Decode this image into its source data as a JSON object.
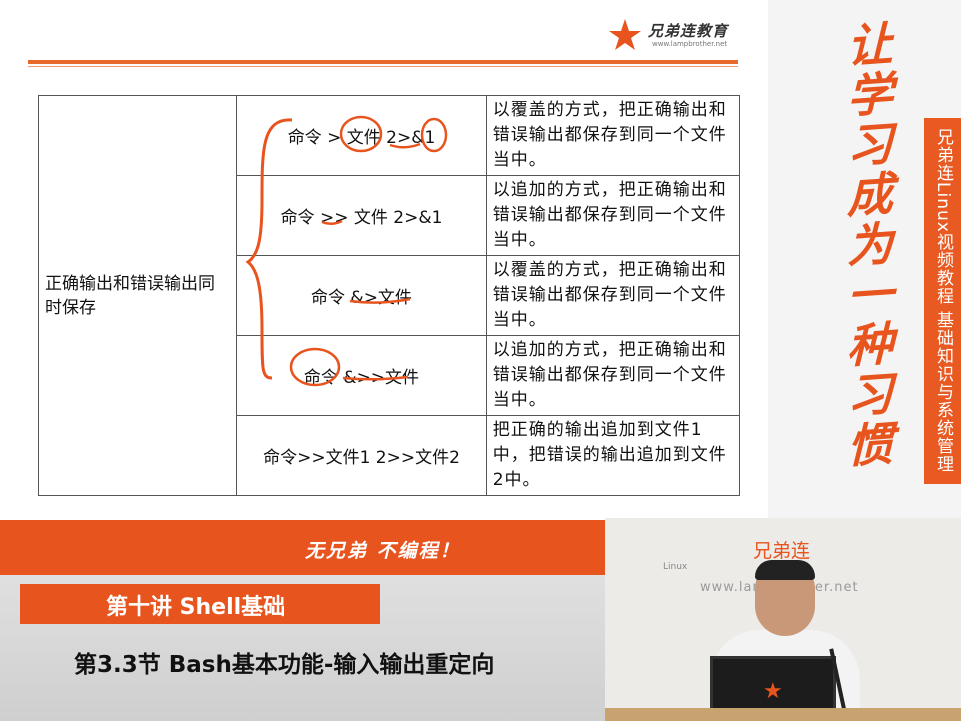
{
  "logo": {
    "brand_text": "兄弟连教育",
    "url": "www.lampbrother.net"
  },
  "table": {
    "left_label": "正确输出和错误输出同时保存",
    "rows": [
      {
        "command": "命令 > 文件 2>&1",
        "description": "以覆盖的方式，把正确输出和错误输出都保存到同一个文件当中。"
      },
      {
        "command": "命令 >> 文件 2>&1",
        "description": "以追加的方式，把正确输出和错误输出都保存到同一个文件当中。"
      },
      {
        "command": "命令 &>文件",
        "description": "以覆盖的方式，把正确输出和错误输出都保存到同一个文件当中。"
      },
      {
        "command": "命令 &>>文件",
        "description": "以追加的方式，把正确输出和错误输出都保存到同一个文件当中。"
      },
      {
        "command": "命令>>文件1  2>>文件2",
        "description": "把正确的输出追加到文件1中，把错误的输出追加到文件2中。"
      }
    ]
  },
  "right_banner": {
    "slogan": "让学习成为一种习惯",
    "tab": "兄弟连Linux视频教程 基础知识与系统管理"
  },
  "bottom": {
    "motto": "无兄弟 不编程！",
    "lecture": "第十讲 Shell基础",
    "section": "第3.3节 Bash基本功能-输入输出重定向"
  },
  "webcam": {
    "brand": "兄弟连",
    "linux": "Linux",
    "url": "www.lampbrother.net"
  },
  "colors": {
    "accent": "#e8541e",
    "annotation": "#e8541e"
  }
}
